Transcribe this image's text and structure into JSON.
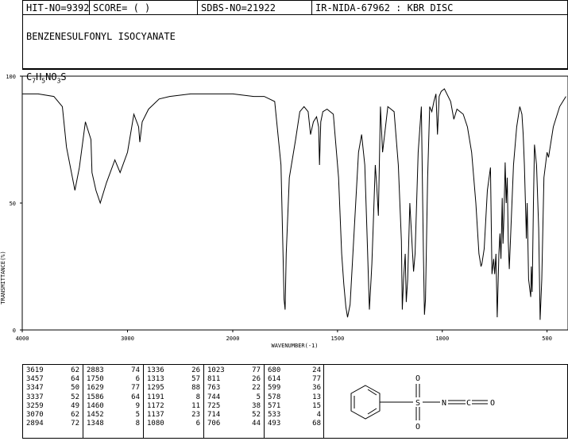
{
  "header": {
    "hit_no": "HIT-NO=9392",
    "score": "SCORE=  (   )",
    "sdbs_no": "SDBS-NO=21922",
    "ir_info": "IR-NIDA-67962 : KBR DISC"
  },
  "compound_name": "BENZENESULFONYL ISOCYANATE",
  "formula": {
    "c": "C",
    "c_n": "7",
    "h": "H",
    "h_n": "5",
    "n": "N",
    "o": "O",
    "o_n": "3",
    "s": "S"
  },
  "chart_data": {
    "type": "line",
    "xlabel": "WAVENUMBER(-1)",
    "ylabel": "TRANSMITTANCE(%)",
    "xlim": [
      4000,
      400
    ],
    "ylim": [
      0,
      100
    ],
    "x_ticks": [
      4000,
      3000,
      2000,
      1500,
      1000,
      500
    ],
    "y_ticks": [
      0,
      50,
      100
    ],
    "x_tick_labels": [
      "4000",
      "3000",
      "2000",
      "1500",
      "1000",
      "500"
    ],
    "y_tick_labels": [
      "0",
      "50",
      "100"
    ],
    "series": [
      {
        "x": [
          4000,
          3850,
          3700,
          3619,
          3580,
          3500,
          3457,
          3400,
          3347,
          3337,
          3300,
          3259,
          3200,
          3120,
          3070,
          3000,
          2940,
          2894,
          2883,
          2860,
          2800,
          2700,
          2600,
          2400,
          2200,
          2000,
          1900,
          1850,
          1800,
          1770,
          1755,
          1750,
          1745,
          1730,
          1700,
          1680,
          1660,
          1640,
          1629,
          1615,
          1600,
          1590,
          1586,
          1580,
          1570,
          1550,
          1520,
          1495,
          1480,
          1470,
          1460,
          1452,
          1440,
          1420,
          1400,
          1385,
          1370,
          1360,
          1348,
          1340,
          1336,
          1330,
          1320,
          1313,
          1305,
          1295,
          1285,
          1260,
          1230,
          1210,
          1195,
          1191,
          1185,
          1177,
          1172,
          1165,
          1155,
          1145,
          1137,
          1130,
          1115,
          1100,
          1090,
          1085,
          1080,
          1070,
          1060,
          1050,
          1040,
          1030,
          1023,
          1015,
          1005,
          990,
          960,
          945,
          930,
          900,
          880,
          860,
          840,
          825,
          815,
          811,
          800,
          785,
          770,
          763,
          755,
          750,
          744,
          738,
          730,
          725,
          720,
          714,
          710,
          706,
          700,
          695,
          690,
          685,
          680,
          670,
          660,
          645,
          630,
          620,
          614,
          608,
          600,
          599,
          595,
          588,
          578,
          575,
          571,
          565,
          560,
          550,
          540,
          533,
          525,
          515,
          500,
          493,
          470,
          440,
          410
        ],
        "y": [
          93,
          93,
          92,
          88,
          72,
          55,
          64,
          82,
          75,
          62,
          55,
          50,
          58,
          67,
          62,
          70,
          85,
          80,
          74,
          82,
          87,
          91,
          92,
          93,
          93,
          93,
          92,
          92,
          90,
          65,
          12,
          8,
          30,
          60,
          75,
          86,
          88,
          86,
          77,
          82,
          84,
          80,
          65,
          82,
          86,
          87,
          85,
          60,
          30,
          18,
          9,
          5,
          10,
          40,
          70,
          77,
          65,
          40,
          8,
          20,
          26,
          40,
          65,
          57,
          45,
          88,
          70,
          88,
          86,
          65,
          35,
          8,
          20,
          30,
          11,
          20,
          50,
          35,
          23,
          30,
          70,
          88,
          30,
          6,
          12,
          60,
          88,
          86,
          90,
          93,
          77,
          92,
          94,
          95,
          90,
          83,
          87,
          85,
          80,
          70,
          50,
          30,
          25,
          26,
          32,
          55,
          64,
          22,
          28,
          22,
          30,
          5,
          30,
          38,
          28,
          52,
          34,
          44,
          66,
          50,
          60,
          35,
          24,
          45,
          65,
          80,
          88,
          85,
          77,
          65,
          40,
          36,
          50,
          20,
          13,
          25,
          15,
          50,
          73,
          65,
          40,
          4,
          20,
          60,
          70,
          68,
          80,
          88,
          92
        ]
      }
    ]
  },
  "peak_table": {
    "columns": [
      [
        [
          "3619",
          "62"
        ],
        [
          "3457",
          "64"
        ],
        [
          "3347",
          "50"
        ],
        [
          "3337",
          "52"
        ],
        [
          "3259",
          "49"
        ],
        [
          "3070",
          "62"
        ],
        [
          "2894",
          "72"
        ]
      ],
      [
        [
          "2883",
          "74"
        ],
        [
          "1750",
          "6"
        ],
        [
          "1629",
          "77"
        ],
        [
          "1586",
          "64"
        ],
        [
          "1460",
          "9"
        ],
        [
          "1452",
          "5"
        ],
        [
          "1348",
          "8"
        ]
      ],
      [
        [
          "1336",
          "26"
        ],
        [
          "1313",
          "57"
        ],
        [
          "1295",
          "88"
        ],
        [
          "1191",
          "8"
        ],
        [
          "1172",
          "11"
        ],
        [
          "1137",
          "23"
        ],
        [
          "1080",
          "6"
        ]
      ],
      [
        [
          "1023",
          "77"
        ],
        [
          "811",
          "26"
        ],
        [
          "763",
          "22"
        ],
        [
          "744",
          "5"
        ],
        [
          "725",
          "38"
        ],
        [
          "714",
          "52"
        ],
        [
          "706",
          "44"
        ]
      ],
      [
        [
          "680",
          "24"
        ],
        [
          "614",
          "77"
        ],
        [
          "599",
          "36"
        ],
        [
          "578",
          "13"
        ],
        [
          "571",
          "15"
        ],
        [
          "533",
          "4"
        ],
        [
          "493",
          "68"
        ]
      ]
    ]
  },
  "structure": {
    "o_top": "O",
    "o_bottom": "O",
    "s": "S",
    "n": "N",
    "c": "C",
    "o_right": "O"
  }
}
